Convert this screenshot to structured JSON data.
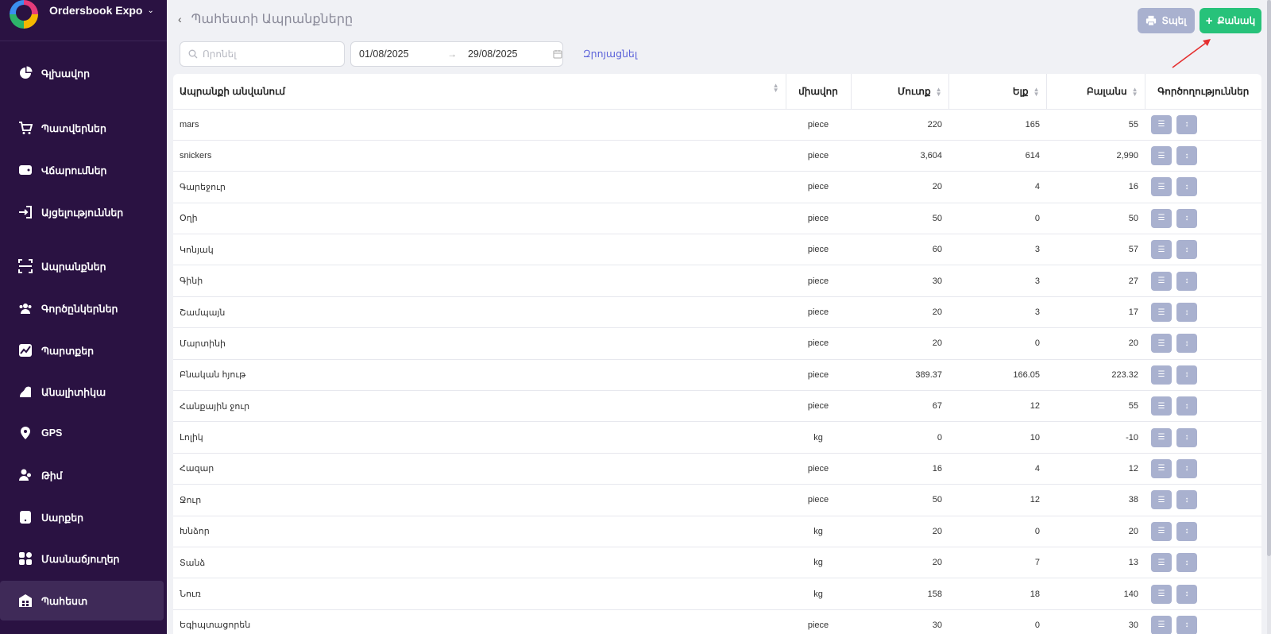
{
  "app": {
    "name": "Ordersbook Expo"
  },
  "sidebar": {
    "items": [
      {
        "label": "Գլխավոր",
        "icon": "pie-chart-icon"
      },
      {
        "label": "Պատվերներ",
        "icon": "cart-icon"
      },
      {
        "label": "Վճարումներ",
        "icon": "wallet-icon"
      },
      {
        "label": "Այցելություններ",
        "icon": "login-icon"
      },
      {
        "label": "Ապրանքներ",
        "icon": "scan-icon"
      },
      {
        "label": "Գործընկերներ",
        "icon": "users-icon"
      },
      {
        "label": "Պարտքեր",
        "icon": "trend-icon"
      },
      {
        "label": "Անալիտիկա",
        "icon": "analytics-icon"
      },
      {
        "label": "GPS",
        "icon": "location-pin-icon"
      },
      {
        "label": "Թիմ",
        "icon": "team-icon"
      },
      {
        "label": "Սարքեր",
        "icon": "device-icon"
      },
      {
        "label": "Մասնաճյուղեր",
        "icon": "branches-icon"
      },
      {
        "label": "Պահեստ",
        "icon": "warehouse-icon",
        "active": true
      }
    ]
  },
  "header": {
    "title": "Պահեստի Ապրանքները",
    "print_label": "Տպել",
    "add_label": "Քանակ"
  },
  "filters": {
    "search_placeholder": "Որոնել",
    "date_from": "01/08/2025",
    "date_to": "29/08/2025",
    "reset_label": "Զրոյացնել"
  },
  "table": {
    "columns": [
      "Ապրանքի անվանում",
      "միավոր",
      "Մուտք",
      "Ելք",
      "Բալանս",
      "Գործողություններ"
    ],
    "rows": [
      [
        "mars",
        "piece",
        "220",
        "165",
        "55"
      ],
      [
        "snickers",
        "piece",
        "3,604",
        "614",
        "2,990"
      ],
      [
        "Գարեջուր",
        "piece",
        "20",
        "4",
        "16"
      ],
      [
        "Օղի",
        "piece",
        "50",
        "0",
        "50"
      ],
      [
        "Կոնյակ",
        "piece",
        "60",
        "3",
        "57"
      ],
      [
        "Գինի",
        "piece",
        "30",
        "3",
        "27"
      ],
      [
        "Շամպայն",
        "piece",
        "20",
        "3",
        "17"
      ],
      [
        "Մարտինի",
        "piece",
        "20",
        "0",
        "20"
      ],
      [
        "Բնական հյութ",
        "piece",
        "389.37",
        "166.05",
        "223.32"
      ],
      [
        "Հանքային ջուր",
        "piece",
        "67",
        "12",
        "55"
      ],
      [
        "Լոլիկ",
        "kg",
        "0",
        "10",
        "-10"
      ],
      [
        "Հազար",
        "piece",
        "16",
        "4",
        "12"
      ],
      [
        "Ջուր",
        "piece",
        "50",
        "12",
        "38"
      ],
      [
        "Խնձոր",
        "kg",
        "20",
        "0",
        "20"
      ],
      [
        "Տանձ",
        "kg",
        "20",
        "7",
        "13"
      ],
      [
        "Նուռ",
        "kg",
        "158",
        "18",
        "140"
      ],
      [
        "Եգիպտացորեն",
        "piece",
        "30",
        "0",
        "30"
      ]
    ]
  },
  "colors": {
    "sidebar_bg": "#2a1242",
    "add_button": "#27c27a",
    "print_button": "#a9b1cf",
    "link": "#5b62d9",
    "annotation_arrow": "#e53030"
  }
}
